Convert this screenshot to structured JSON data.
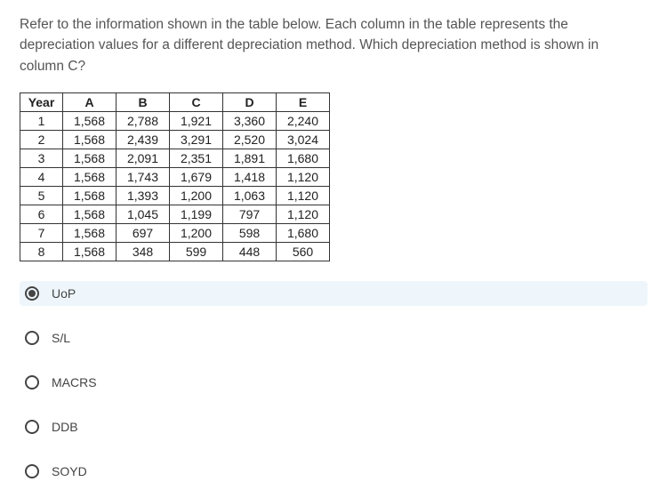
{
  "question": "Refer to the information shown in the table below. Each column in the table represents the depreciation values for a different depreciation method. Which depreciation method is shown in column C?",
  "table": {
    "headers": [
      "Year",
      "A",
      "B",
      "C",
      "D",
      "E"
    ],
    "rows": [
      [
        "1",
        "1,568",
        "2,788",
        "1,921",
        "3,360",
        "2,240"
      ],
      [
        "2",
        "1,568",
        "2,439",
        "3,291",
        "2,520",
        "3,024"
      ],
      [
        "3",
        "1,568",
        "2,091",
        "2,351",
        "1,891",
        "1,680"
      ],
      [
        "4",
        "1,568",
        "1,743",
        "1,679",
        "1,418",
        "1,120"
      ],
      [
        "5",
        "1,568",
        "1,393",
        "1,200",
        "1,063",
        "1,120"
      ],
      [
        "6",
        "1,568",
        "1,045",
        "1,199",
        "797",
        "1,120"
      ],
      [
        "7",
        "1,568",
        "697",
        "1,200",
        "598",
        "1,680"
      ],
      [
        "8",
        "1,568",
        "348",
        "599",
        "448",
        "560"
      ]
    ]
  },
  "options": [
    {
      "label": "UoP",
      "selected": true
    },
    {
      "label": "S/L",
      "selected": false
    },
    {
      "label": "MACRS",
      "selected": false
    },
    {
      "label": "DDB",
      "selected": false
    },
    {
      "label": "SOYD",
      "selected": false
    }
  ],
  "chart_data": {
    "type": "table",
    "title": "Depreciation values by method",
    "columns": [
      "Year",
      "A",
      "B",
      "C",
      "D",
      "E"
    ],
    "rows": [
      [
        1,
        1568,
        2788,
        1921,
        3360,
        2240
      ],
      [
        2,
        1568,
        2439,
        3291,
        2520,
        3024
      ],
      [
        3,
        1568,
        2091,
        2351,
        1891,
        1680
      ],
      [
        4,
        1568,
        1743,
        1679,
        1418,
        1120
      ],
      [
        5,
        1568,
        1393,
        1200,
        1063,
        1120
      ],
      [
        6,
        1568,
        1045,
        1199,
        797,
        1120
      ],
      [
        7,
        1568,
        697,
        1200,
        598,
        1680
      ],
      [
        8,
        1568,
        348,
        599,
        448,
        560
      ]
    ]
  }
}
